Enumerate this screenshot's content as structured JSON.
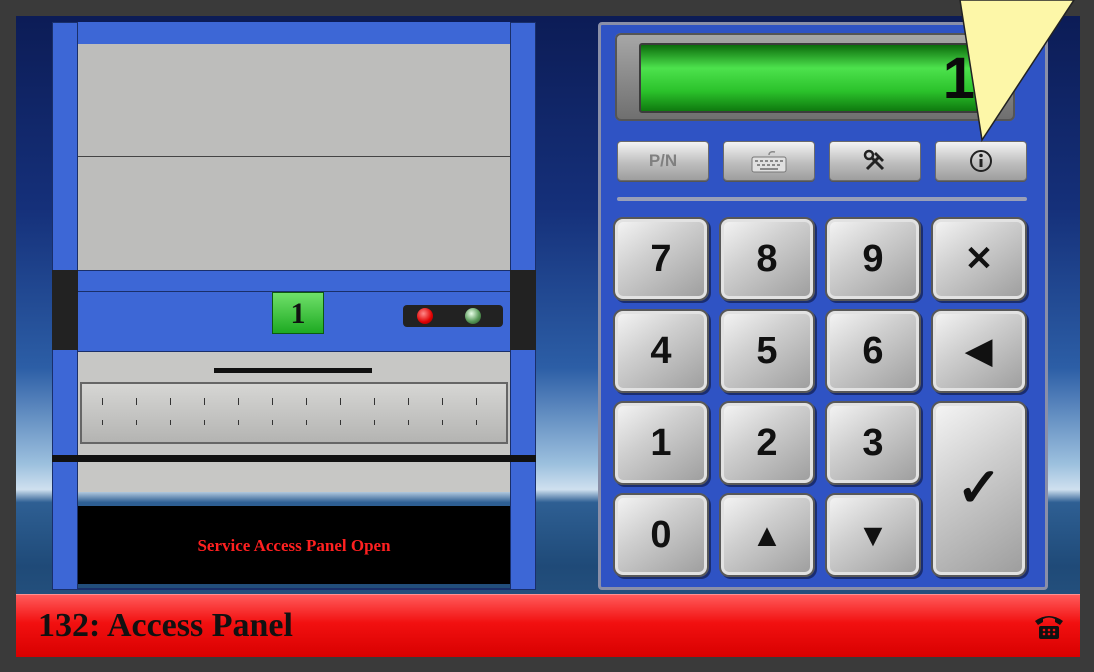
{
  "tray": {
    "number": "1"
  },
  "status_panel": {
    "message": "Service Access Panel Open"
  },
  "keypad": {
    "display_value": "1",
    "function_buttons": [
      {
        "label": "P/N",
        "icon": "pn-icon"
      },
      {
        "label": "",
        "icon": "keyboard-icon"
      },
      {
        "label": "",
        "icon": "tools-icon"
      },
      {
        "label": "",
        "icon": "info-icon"
      }
    ],
    "keys": {
      "k7": "7",
      "k8": "8",
      "k9": "9",
      "del": "✕",
      "k4": "4",
      "k5": "5",
      "k6": "6",
      "back": "◀",
      "k1": "1",
      "k2": "2",
      "k3": "3",
      "enter": "✓",
      "k0": "0",
      "up": "▲",
      "down": "▼"
    }
  },
  "footer": {
    "alarm_text": "132: Access Panel",
    "icon": "phone-icon"
  },
  "colors": {
    "machine_blue": "#3d67d6",
    "display_green": "#2bc22b",
    "alarm_red": "#f21010",
    "status_text_red": "#ff2020",
    "pointer_yellow": "#fdf7a8"
  }
}
